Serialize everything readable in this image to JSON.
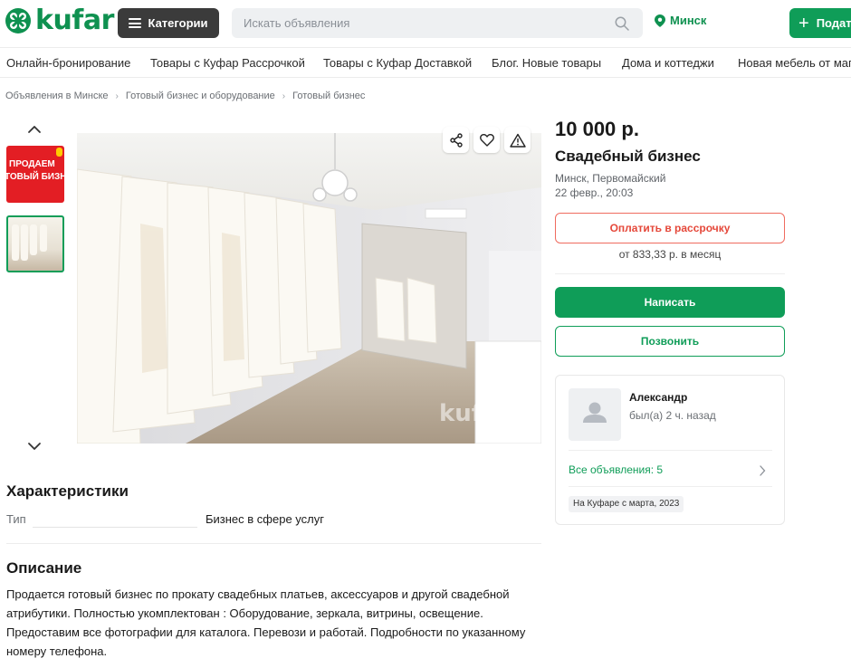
{
  "header": {
    "logo_text": "kufar",
    "categories_label": "Категории",
    "search_placeholder": "Искать объявления",
    "city": "Минск",
    "submit_label": "Подат"
  },
  "nav_links": [
    "Онлайн-бронирование",
    "Товары с Куфар Рассрочкой",
    "Товары с Куфар Доставкой",
    "Блог. Новые товары",
    "Дома и коттеджи",
    "Новая мебель от мага"
  ],
  "breadcrumb": [
    "Объявления в Минске",
    "Готовый бизнес и оборудование",
    "Готовый бизнес"
  ],
  "gallery": {
    "thumb1_line1": "ПРОДАЕМ",
    "thumb1_line2": "ТОВЫЙ БИЗНЕ",
    "watermark": "kufar"
  },
  "listing": {
    "price": "10 000 р.",
    "title": "Свадебный бизнес",
    "location": "Минск, Первомайский",
    "date": "22 февр., 20:03",
    "installment_label": "Оплатить в рассрочку",
    "monthly": "от 833,33 р. в месяц",
    "write_label": "Написать",
    "call_label": "Позвонить"
  },
  "seller": {
    "name": "Александр",
    "last_seen": "был(а) 2 ч. назад",
    "all_ads": "Все объявления: 5",
    "since": "На Куфаре с марта, 2023"
  },
  "characteristics": {
    "heading": "Характеристики",
    "type_label": "Тип",
    "type_value": "Бизнес в сфере услуг"
  },
  "description": {
    "heading": "Описание",
    "text": "Продается готовый бизнес по прокату свадебных платьев, аксессуаров и другой свадебной атрибутики. Полностью укомплектован : Оборудование, зеркала, витрины, освещение. Предоставим все фотографии для каталога. Перевози и работай. Подробности по указанному номеру телефона."
  },
  "colors": {
    "brand_green": "#0f9d58",
    "accent_red": "#e5483a",
    "dark_button": "#3b3b3b"
  }
}
